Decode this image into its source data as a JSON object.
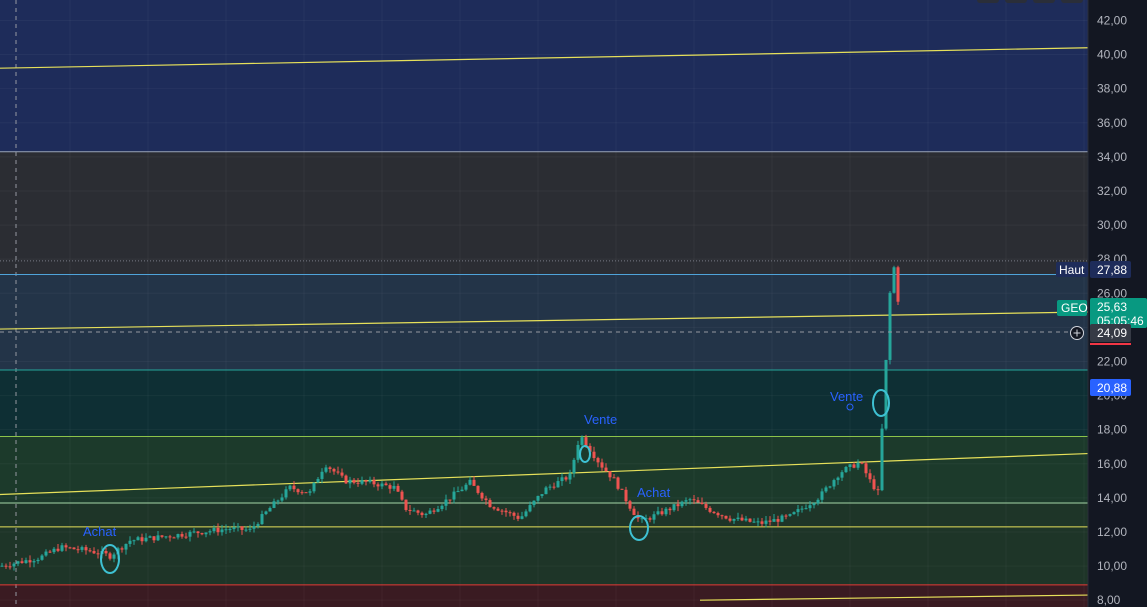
{
  "chart_data": {
    "type": "candlestick",
    "symbol": "GEO",
    "ylim": [
      7.6,
      43.2
    ],
    "y_ticks": [
      "42,00",
      "40,00",
      "38,00",
      "36,00",
      "34,00",
      "32,00",
      "30,00",
      "28,00",
      "26,00",
      "24,00",
      "22,00",
      "20,00",
      "18,00",
      "16,00",
      "14,00",
      "12,00",
      "10,00",
      "8,00"
    ],
    "zones": [
      {
        "from": 34.3,
        "to": 43.2,
        "color": "#1e2c5a"
      },
      {
        "from": 27.1,
        "to": 34.3,
        "color": "#2b2d33"
      },
      {
        "from": 21.5,
        "to": 27.1,
        "color": "#233448"
      },
      {
        "from": 17.6,
        "to": 21.5,
        "color": "#0e2f34"
      },
      {
        "from": 13.7,
        "to": 17.6,
        "color": "#1c3a2b"
      },
      {
        "from": 8.9,
        "to": 13.7,
        "color": "#1e3528"
      },
      {
        "from": 7.6,
        "to": 8.9,
        "color": "#3a1b22"
      }
    ],
    "horizontal_levels": [
      {
        "price": 34.3,
        "color": "#9aa3b5"
      },
      {
        "price": 27.9,
        "color": "#787b86",
        "style": "dotted"
      },
      {
        "price": 27.1,
        "color": "#4fa3d9"
      },
      {
        "price": 21.5,
        "color": "#26a69a"
      },
      {
        "price": 17.6,
        "color": "#8bc34a"
      },
      {
        "price": 13.7,
        "color": "#a5d6a7"
      },
      {
        "price": 12.3,
        "color": "#e6e05a"
      },
      {
        "price": 8.9,
        "color": "#e53935"
      }
    ],
    "trendlines": [
      {
        "from": [
          0,
          39.2
        ],
        "to": [
          1088,
          40.4
        ]
      },
      {
        "from": [
          0,
          23.9
        ],
        "to": [
          1088,
          24.9
        ]
      },
      {
        "from": [
          0,
          14.2
        ],
        "to": [
          1088,
          16.6
        ]
      },
      {
        "from": [
          700,
          8.0
        ],
        "to": [
          1088,
          8.3
        ]
      }
    ],
    "price_path": [
      [
        0,
        10.0
      ],
      [
        40,
        10.5
      ],
      [
        60,
        11.1
      ],
      [
        90,
        10.9
      ],
      [
        110,
        10.6
      ],
      [
        130,
        11.5
      ],
      [
        160,
        11.7
      ],
      [
        200,
        12.0
      ],
      [
        230,
        12.2
      ],
      [
        250,
        12.1
      ],
      [
        270,
        13.4
      ],
      [
        290,
        14.6
      ],
      [
        310,
        14.3
      ],
      [
        325,
        16.0
      ],
      [
        345,
        15.0
      ],
      [
        370,
        14.9
      ],
      [
        395,
        14.6
      ],
      [
        405,
        13.4
      ],
      [
        425,
        13.0
      ],
      [
        445,
        13.8
      ],
      [
        470,
        14.9
      ],
      [
        490,
        13.6
      ],
      [
        520,
        12.8
      ],
      [
        545,
        14.5
      ],
      [
        570,
        15.3
      ],
      [
        580,
        17.7
      ],
      [
        600,
        16.0
      ],
      [
        615,
        15.0
      ],
      [
        630,
        13.5
      ],
      [
        640,
        12.6
      ],
      [
        660,
        13.1
      ],
      [
        690,
        13.9
      ],
      [
        710,
        13.3
      ],
      [
        730,
        12.8
      ],
      [
        760,
        12.5
      ],
      [
        790,
        12.9
      ],
      [
        820,
        14.1
      ],
      [
        840,
        15.5
      ],
      [
        860,
        16.1
      ],
      [
        870,
        15.0
      ],
      [
        878,
        14.3
      ],
      [
        882,
        18.0
      ],
      [
        886,
        22.0
      ],
      [
        890,
        26.0
      ],
      [
        894,
        27.5
      ],
      [
        898,
        25.63
      ]
    ],
    "labels": {
      "high_label": "Haut",
      "high_value": "27,88",
      "symbol_tag": "GEO",
      "last_value": "25,63",
      "countdown": "05:05:46",
      "crosshair_value": "24,09",
      "level_value": "20,88"
    },
    "annotations": [
      "Achat",
      "Vente",
      "Achat",
      "Vente"
    ],
    "colors": {
      "up": "#26a69a",
      "down": "#ef5350",
      "trend": "#e6e05a",
      "annotation": "#2962ff",
      "circle": "#3ec1d3"
    }
  }
}
